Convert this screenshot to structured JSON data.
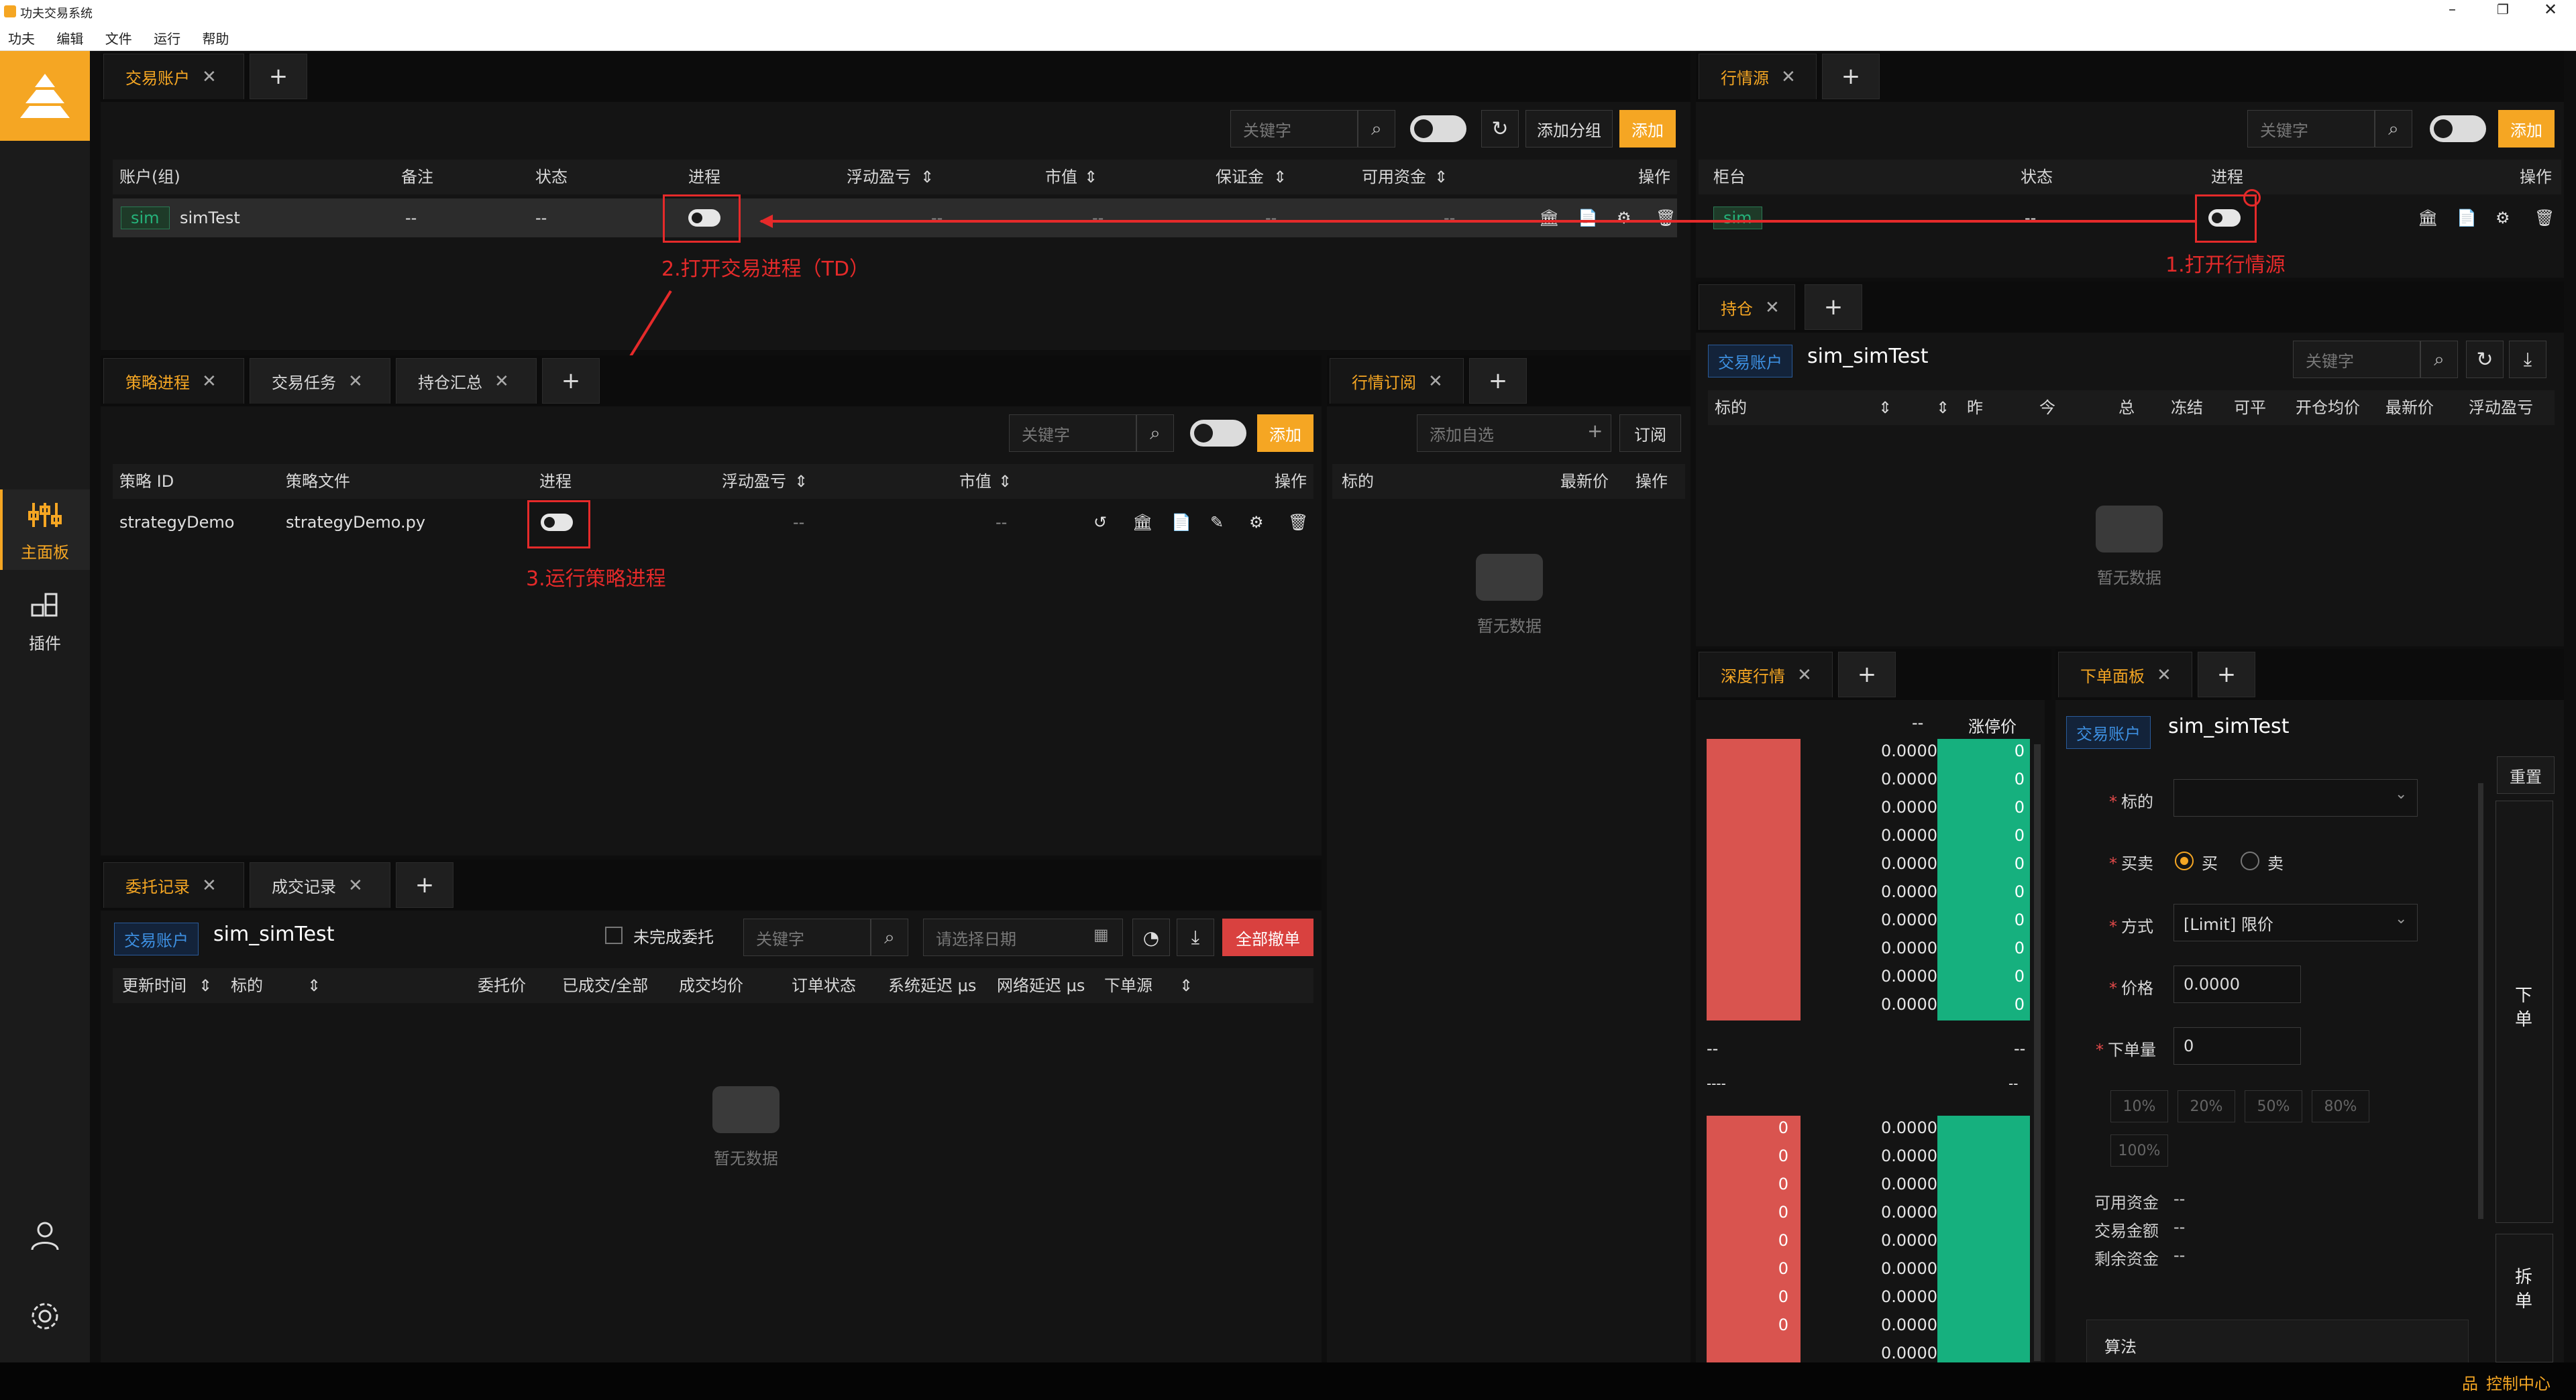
{
  "window": {
    "title": "功夫交易系统"
  },
  "menu": [
    "功夫",
    "编辑",
    "文件",
    "运行",
    "帮助"
  ],
  "sidebar": {
    "main_label": "主面板",
    "plugins_label": "插件"
  },
  "accounts_panel": {
    "tab_label": "交易账户",
    "search_placeholder": "关键字",
    "add_group_label": "添加分组",
    "add_label": "添加",
    "columns": [
      "账户(组)",
      "备注",
      "状态",
      "进程",
      "浮动盈亏",
      "市值",
      "保证金",
      "可用资金",
      "操作"
    ],
    "row": {
      "tag": "sim",
      "name": "simTest",
      "remark": "--",
      "status": "--",
      "pnl": "--",
      "market_value": "--",
      "margin": "--",
      "available": "--"
    }
  },
  "md_panel": {
    "tab_label": "行情源",
    "search_placeholder": "关键字",
    "add_label": "添加",
    "columns": [
      "柜台",
      "状态",
      "进程",
      "操作"
    ],
    "row": {
      "name": "sim",
      "status": "--"
    }
  },
  "strategy_panel": {
    "tabs": [
      "策略进程",
      "交易任务",
      "持仓汇总"
    ],
    "search_placeholder": "关键字",
    "add_label": "添加",
    "columns": [
      "策略 ID",
      "策略文件",
      "进程",
      "浮动盈亏",
      "市值",
      "操作"
    ],
    "row": {
      "id": "strategyDemo",
      "file": "strategyDemo.py",
      "pnl": "--",
      "market_value": "--"
    }
  },
  "subscribe_panel": {
    "tab_label": "行情订阅",
    "add_placeholder": "添加自选",
    "subscribe_label": "订阅",
    "columns": [
      "标的",
      "最新价",
      "操作"
    ],
    "empty_text": "暂无数据"
  },
  "positions_panel": {
    "tab_label": "持仓",
    "account_badge": "交易账户",
    "account_name": "sim_simTest",
    "search_placeholder": "关键字",
    "columns": [
      "标的",
      "昨",
      "今",
      "总",
      "冻结",
      "可平",
      "开仓均价",
      "最新价",
      "浮动盈亏"
    ],
    "empty_text": "暂无数据"
  },
  "orders_panel": {
    "tabs": [
      "委托记录",
      "成交记录"
    ],
    "account_badge": "交易账户",
    "account_name": "sim_simTest",
    "unfinished_label": "未完成委托",
    "search_placeholder": "关键字",
    "date_placeholder": "请选择日期",
    "cancel_all_label": "全部撤单",
    "columns": [
      "更新时间",
      "标的",
      "委托价",
      "已成交/全部",
      "成交均价",
      "订单状态",
      "系统延迟 μs",
      "网络延迟 μs",
      "下单源"
    ],
    "empty_text": "暂无数据"
  },
  "depth_panel": {
    "tab_label": "深度行情",
    "header_dash": "--",
    "header_limit": "涨停价",
    "ask_prices": [
      "0.0000",
      "0.0000",
      "0.0000",
      "0.0000",
      "0.0000",
      "0.0000",
      "0.0000",
      "0.0000",
      "0.0000",
      "0.0000"
    ],
    "ask_volumes": [
      "0",
      "0",
      "0",
      "0",
      "0",
      "0",
      "0",
      "0",
      "0",
      "0"
    ],
    "mid_left": "--",
    "mid_right": "--",
    "mid_left2": "----",
    "mid_right2": "--",
    "bid_prices": [
      "0.0000",
      "0.0000",
      "0.0000",
      "0.0000",
      "0.0000",
      "0.0000",
      "0.0000",
      "0.0000",
      "0.0000"
    ],
    "bid_volumes": [
      "0",
      "0",
      "0",
      "0",
      "0",
      "0",
      "0",
      "0"
    ]
  },
  "order_form": {
    "tab_label": "下单面板",
    "account_badge": "交易账户",
    "account_name": "sim_simTest",
    "reset_label": "重置",
    "instrument_label": "标的",
    "side_label": "买卖",
    "buy_label": "买",
    "sell_label": "卖",
    "mode_label": "方式",
    "mode_value": "[Limit] 限价",
    "price_label": "价格",
    "price_value": "0.0000",
    "volume_label": "下单量",
    "volume_value": "0",
    "pcts": [
      "10%",
      "20%",
      "50%",
      "80%",
      "100%"
    ],
    "available_label": "可用资金",
    "available_value": "--",
    "trade_amount_label": "交易金额",
    "trade_amount_value": "--",
    "remaining_label": "剩余资金",
    "remaining_value": "--",
    "algo_label": "算法",
    "place_order_label": "下单",
    "split_order_label": "拆单"
  },
  "annotations": {
    "step1": "1.打开行情源",
    "step2": "2.打开交易进程（TD）",
    "step3": "3.运行策略进程"
  },
  "statusbar": {
    "control_center": "控制中心"
  }
}
